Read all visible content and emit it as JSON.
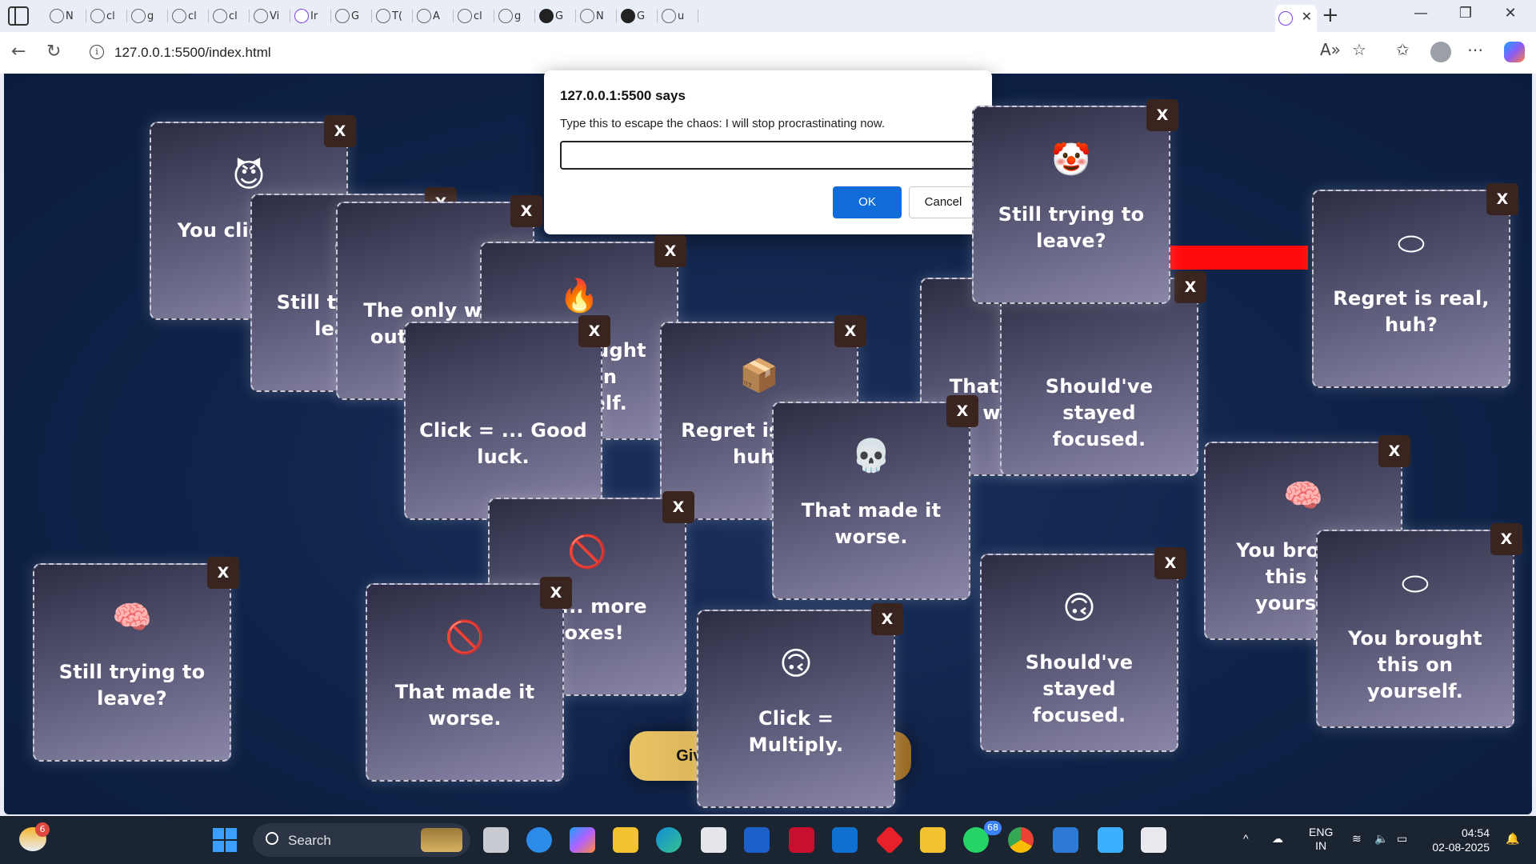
{
  "browser": {
    "tabs": [
      {
        "icon": "page-icon",
        "label": "N"
      },
      {
        "icon": "globe-icon",
        "label": "cl"
      },
      {
        "icon": "globe-icon",
        "label": "g"
      },
      {
        "icon": "globe-icon",
        "label": "cl"
      },
      {
        "icon": "globe-icon",
        "label": "cl"
      },
      {
        "icon": "globe-icon",
        "label": "Vi"
      },
      {
        "icon": "extension-icon",
        "label": "Ir"
      },
      {
        "icon": "gmail-icon",
        "label": "G"
      },
      {
        "icon": "cloud-icon",
        "label": "T("
      },
      {
        "icon": "text-icon",
        "label": "A"
      },
      {
        "icon": "globe-icon",
        "label": "cl"
      },
      {
        "icon": "search-icon",
        "label": "g"
      },
      {
        "icon": "github-icon",
        "label": "G"
      },
      {
        "icon": "globe-icon",
        "label": "N"
      },
      {
        "icon": "github-icon",
        "label": "G"
      },
      {
        "icon": "globe-icon",
        "label": "u"
      }
    ],
    "url": "127.0.0.1:5500/index.html",
    "active_tab_close": "✕",
    "new_tab": "+"
  },
  "dialog": {
    "title": "127.0.0.1:5500 says",
    "message": "Type this to escape the chaos: I will stop procrastinating now.",
    "input_value": "",
    "ok_label": "OK",
    "cancel_label": "Cancel"
  },
  "popups": [
    {
      "emoji": "😈",
      "text": "You click aga",
      "close": "X"
    },
    {
      "emoji": "😈",
      "text": "Still trying to leave?",
      "close": "X"
    },
    {
      "emoji": "",
      "text": "The only way out is work.",
      "close": "X"
    },
    {
      "emoji": "🔥",
      "text": "You brought this on yourself.",
      "close": "X"
    },
    {
      "emoji": "",
      "text": "Click = ... Good luck.",
      "close": "X"
    },
    {
      "emoji": "📦",
      "text": "Regret is real, huh?",
      "close": "X"
    },
    {
      "emoji": "🤡",
      "text": "That made it worse.",
      "close": "X"
    },
    {
      "emoji": "",
      "text": "Should've stayed focused.",
      "close": "X"
    },
    {
      "emoji": "🤡",
      "text": "Still trying to leave?",
      "close": "X"
    },
    {
      "emoji": "⬭",
      "text": "Regret is real, huh?",
      "close": "X"
    },
    {
      "emoji": "💀",
      "text": "That made it worse.",
      "close": "X"
    },
    {
      "emoji": "🧠",
      "text": "You brought this on yourself.",
      "close": "X"
    },
    {
      "emoji": "⬭",
      "text": "You brought this on yourself.",
      "close": "X"
    },
    {
      "emoji": "🚫",
      "text": "...s... more boxes!",
      "close": "X"
    },
    {
      "emoji": "🙃",
      "text": "Click = Multiply.",
      "close": "X"
    },
    {
      "emoji": "🙃",
      "text": "Should've stayed focused.",
      "close": "X"
    },
    {
      "emoji": "🚫",
      "text": "That made it worse.",
      "close": "X"
    },
    {
      "emoji": "🧠",
      "text": "Still trying to leave?",
      "close": "X"
    }
  ],
  "give_up_button": "Give Up & Be Productive",
  "taskbar": {
    "weather_badge": "6",
    "search_label": "Search",
    "whatsapp_badge": "68",
    "lang_line1": "ENG",
    "lang_line2": "IN",
    "time": "04:54",
    "date": "02-08-2025"
  }
}
